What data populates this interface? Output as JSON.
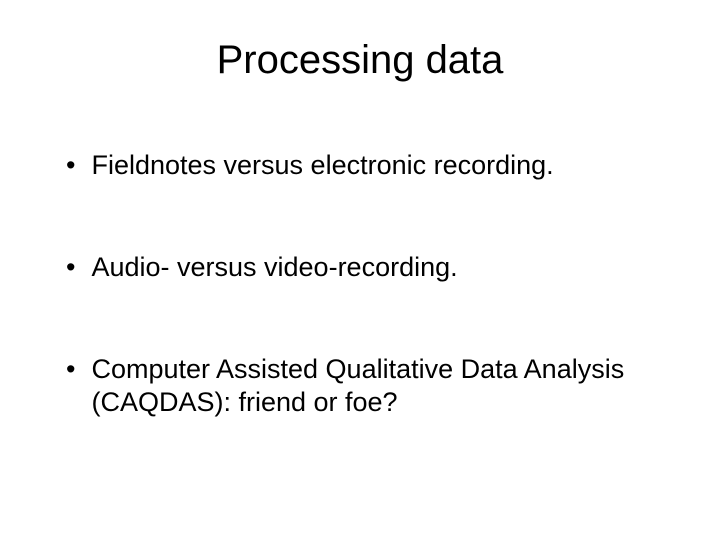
{
  "slide": {
    "title": "Processing data",
    "bullets": [
      {
        "text": "Fieldnotes versus electronic recording."
      },
      {
        "text": "Audio- versus video-recording."
      },
      {
        "text": "Computer Assisted Qualitative Data Analysis (CAQDAS): friend or foe?"
      }
    ]
  }
}
